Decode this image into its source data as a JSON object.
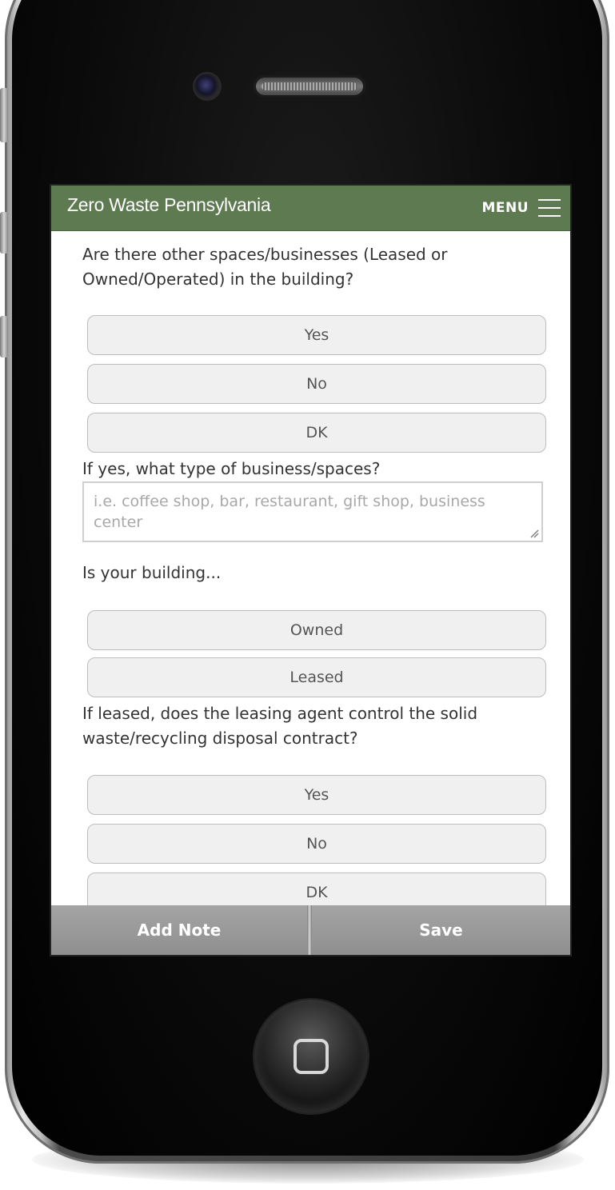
{
  "header": {
    "title": "Zero Waste Pennsylvania",
    "menu_label": "MENU"
  },
  "questions": [
    {
      "text": "Are there other spaces/businesses (Leased or Owned/Operated) in the building?",
      "options": [
        "Yes",
        "No",
        "DK"
      ]
    },
    {
      "text": "If yes, what type of business/spaces?",
      "placeholder": "i.e. coffee shop, bar, restaurant, gift shop, business center",
      "value": ""
    },
    {
      "text": "Is your building...",
      "options": [
        "Owned",
        "Leased"
      ]
    },
    {
      "text": "If leased, does the leasing agent control the solid waste/recycling disposal contract?",
      "options": [
        "Yes",
        "No",
        "DK"
      ]
    }
  ],
  "footer": {
    "add_note_label": "Add Note",
    "save_label": "Save"
  },
  "icons": {
    "menu": "hamburger-icon",
    "home": "home-button-icon"
  },
  "colors": {
    "header_bg": "#5d7a51",
    "footer_bg": "#999999",
    "button_bg": "#f0f0f0"
  }
}
